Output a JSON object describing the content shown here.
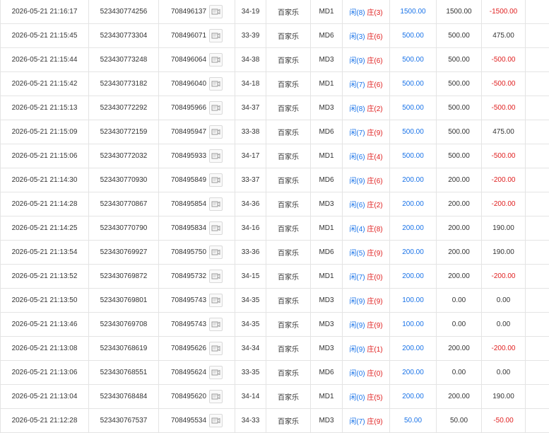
{
  "labels": {
    "player": "闲",
    "banker": "庄"
  },
  "rows": [
    {
      "time": "2026-05-21 21:16:17",
      "bet_id": "523430774256",
      "game_id": "708496137",
      "desk": "34-19",
      "game_type": "百家乐",
      "table": "MD1",
      "player": "(8)",
      "banker": "(3)",
      "amount": "1500.00",
      "valid": "1500.00",
      "winloss": "-1500.00",
      "neg": true
    },
    {
      "time": "2026-05-21 21:15:45",
      "bet_id": "523430773304",
      "game_id": "708496071",
      "desk": "33-39",
      "game_type": "百家乐",
      "table": "MD6",
      "player": "(3)",
      "banker": "(6)",
      "amount": "500.00",
      "valid": "500.00",
      "winloss": "475.00",
      "neg": false
    },
    {
      "time": "2026-05-21 21:15:44",
      "bet_id": "523430773248",
      "game_id": "708496064",
      "desk": "34-38",
      "game_type": "百家乐",
      "table": "MD3",
      "player": "(9)",
      "banker": "(6)",
      "amount": "500.00",
      "valid": "500.00",
      "winloss": "-500.00",
      "neg": true
    },
    {
      "time": "2026-05-21 21:15:42",
      "bet_id": "523430773182",
      "game_id": "708496040",
      "desk": "34-18",
      "game_type": "百家乐",
      "table": "MD1",
      "player": "(7)",
      "banker": "(6)",
      "amount": "500.00",
      "valid": "500.00",
      "winloss": "-500.00",
      "neg": true
    },
    {
      "time": "2026-05-21 21:15:13",
      "bet_id": "523430772292",
      "game_id": "708495966",
      "desk": "34-37",
      "game_type": "百家乐",
      "table": "MD3",
      "player": "(8)",
      "banker": "(2)",
      "amount": "500.00",
      "valid": "500.00",
      "winloss": "-500.00",
      "neg": true
    },
    {
      "time": "2026-05-21 21:15:09",
      "bet_id": "523430772159",
      "game_id": "708495947",
      "desk": "33-38",
      "game_type": "百家乐",
      "table": "MD6",
      "player": "(7)",
      "banker": "(9)",
      "amount": "500.00",
      "valid": "500.00",
      "winloss": "475.00",
      "neg": false
    },
    {
      "time": "2026-05-21 21:15:06",
      "bet_id": "523430772032",
      "game_id": "708495933",
      "desk": "34-17",
      "game_type": "百家乐",
      "table": "MD1",
      "player": "(6)",
      "banker": "(4)",
      "amount": "500.00",
      "valid": "500.00",
      "winloss": "-500.00",
      "neg": true
    },
    {
      "time": "2026-05-21 21:14:30",
      "bet_id": "523430770930",
      "game_id": "708495849",
      "desk": "33-37",
      "game_type": "百家乐",
      "table": "MD6",
      "player": "(9)",
      "banker": "(6)",
      "amount": "200.00",
      "valid": "200.00",
      "winloss": "-200.00",
      "neg": true
    },
    {
      "time": "2026-05-21 21:14:28",
      "bet_id": "523430770867",
      "game_id": "708495854",
      "desk": "34-36",
      "game_type": "百家乐",
      "table": "MD3",
      "player": "(6)",
      "banker": "(2)",
      "amount": "200.00",
      "valid": "200.00",
      "winloss": "-200.00",
      "neg": true
    },
    {
      "time": "2026-05-21 21:14:25",
      "bet_id": "523430770790",
      "game_id": "708495834",
      "desk": "34-16",
      "game_type": "百家乐",
      "table": "MD1",
      "player": "(4)",
      "banker": "(8)",
      "amount": "200.00",
      "valid": "200.00",
      "winloss": "190.00",
      "neg": false
    },
    {
      "time": "2026-05-21 21:13:54",
      "bet_id": "523430769927",
      "game_id": "708495750",
      "desk": "33-36",
      "game_type": "百家乐",
      "table": "MD6",
      "player": "(5)",
      "banker": "(9)",
      "amount": "200.00",
      "valid": "200.00",
      "winloss": "190.00",
      "neg": false
    },
    {
      "time": "2026-05-21 21:13:52",
      "bet_id": "523430769872",
      "game_id": "708495732",
      "desk": "34-15",
      "game_type": "百家乐",
      "table": "MD1",
      "player": "(7)",
      "banker": "(0)",
      "amount": "200.00",
      "valid": "200.00",
      "winloss": "-200.00",
      "neg": true
    },
    {
      "time": "2026-05-21 21:13:50",
      "bet_id": "523430769801",
      "game_id": "708495743",
      "desk": "34-35",
      "game_type": "百家乐",
      "table": "MD3",
      "player": "(9)",
      "banker": "(9)",
      "amount": "100.00",
      "valid": "0.00",
      "winloss": "0.00",
      "neg": false
    },
    {
      "time": "2026-05-21 21:13:46",
      "bet_id": "523430769708",
      "game_id": "708495743",
      "desk": "34-35",
      "game_type": "百家乐",
      "table": "MD3",
      "player": "(9)",
      "banker": "(9)",
      "amount": "100.00",
      "valid": "0.00",
      "winloss": "0.00",
      "neg": false
    },
    {
      "time": "2026-05-21 21:13:08",
      "bet_id": "523430768619",
      "game_id": "708495626",
      "desk": "34-34",
      "game_type": "百家乐",
      "table": "MD3",
      "player": "(9)",
      "banker": "(1)",
      "amount": "200.00",
      "valid": "200.00",
      "winloss": "-200.00",
      "neg": true
    },
    {
      "time": "2026-05-21 21:13:06",
      "bet_id": "523430768551",
      "game_id": "708495624",
      "desk": "33-35",
      "game_type": "百家乐",
      "table": "MD6",
      "player": "(0)",
      "banker": "(0)",
      "amount": "200.00",
      "valid": "0.00",
      "winloss": "0.00",
      "neg": false
    },
    {
      "time": "2026-05-21 21:13:04",
      "bet_id": "523430768484",
      "game_id": "708495620",
      "desk": "34-14",
      "game_type": "百家乐",
      "table": "MD1",
      "player": "(0)",
      "banker": "(5)",
      "amount": "200.00",
      "valid": "200.00",
      "winloss": "190.00",
      "neg": false
    },
    {
      "time": "2026-05-21 21:12:28",
      "bet_id": "523430767537",
      "game_id": "708495534",
      "desk": "34-33",
      "game_type": "百家乐",
      "table": "MD3",
      "player": "(7)",
      "banker": "(9)",
      "amount": "50.00",
      "valid": "50.00",
      "winloss": "-50.00",
      "neg": true
    }
  ],
  "colors": {
    "link_blue": "#1a73e8",
    "loss_red": "#e02020",
    "border": "#e4e4e4"
  }
}
